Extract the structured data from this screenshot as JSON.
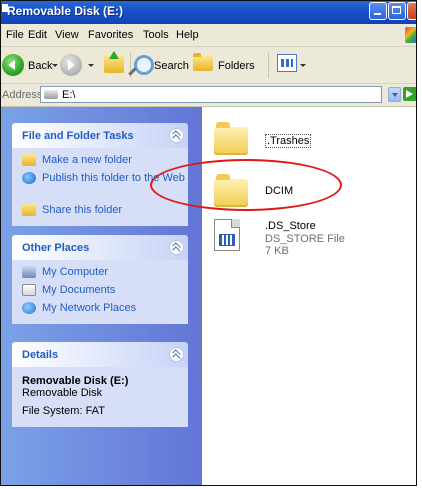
{
  "window": {
    "title": "Removable Disk (E:)"
  },
  "menu": [
    "File",
    "Edit",
    "View",
    "Favorites",
    "Tools",
    "Help"
  ],
  "toolbar": {
    "back_label": "Back",
    "search_label": "Search",
    "folders_label": "Folders"
  },
  "address": {
    "label": "Address",
    "value": "E:\\",
    "go_label": "Go"
  },
  "sidebar": {
    "file_tasks": {
      "title": "File and Folder Tasks",
      "items": [
        "Make a new folder",
        "Publish this folder to the Web",
        "Share this folder"
      ]
    },
    "other_places": {
      "title": "Other Places",
      "items": [
        "My Computer",
        "My Documents",
        "My Network Places"
      ]
    },
    "details": {
      "title": "Details",
      "name": "Removable Disk (E:)",
      "type": "Removable Disk",
      "filesystem": "File System: FAT"
    }
  },
  "files": [
    {
      "name": ".Trashes",
      "kind": "folder"
    },
    {
      "name": "DCIM",
      "kind": "folder"
    },
    {
      "name": ".DS_Store",
      "kind": "file",
      "type": "DS_STORE File",
      "size": "7 KB"
    }
  ],
  "annotation": {
    "shape": "ellipse",
    "color": "#e01818"
  }
}
